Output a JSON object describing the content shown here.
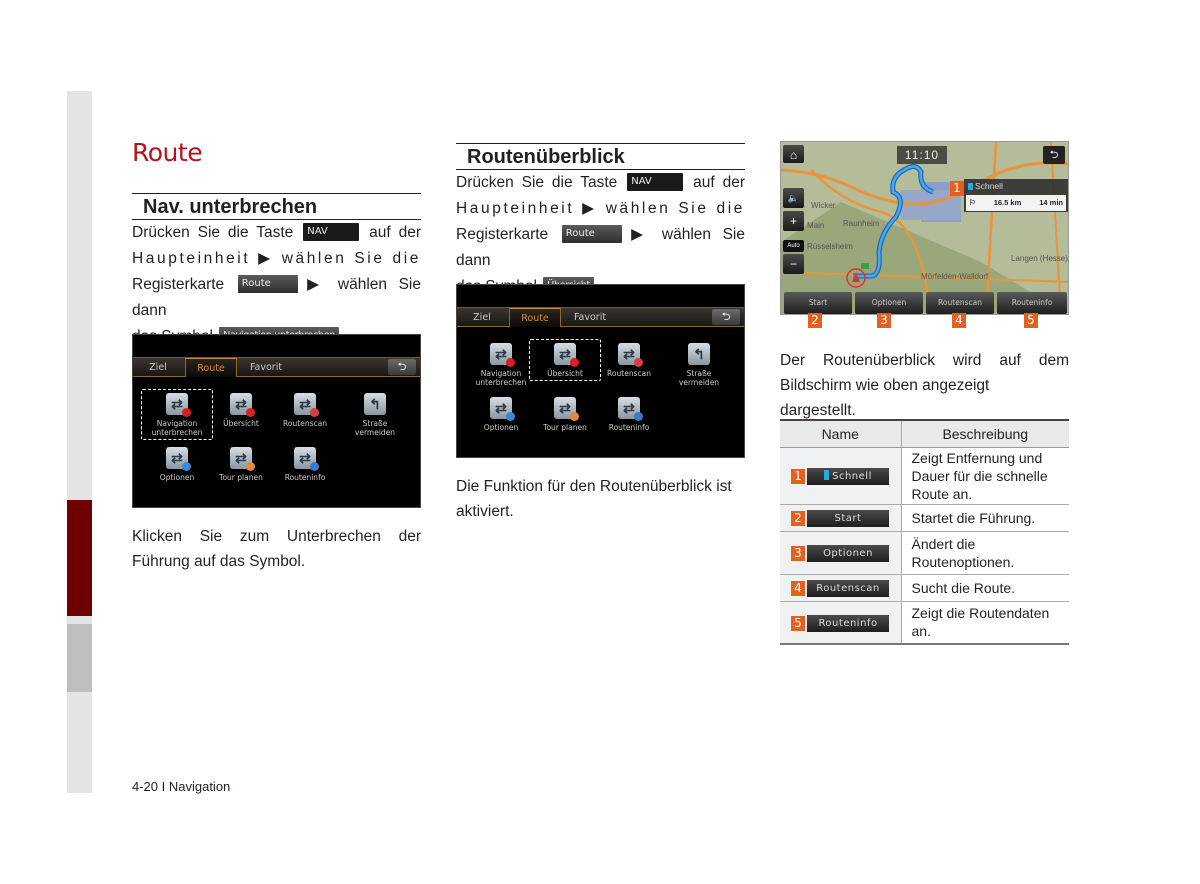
{
  "page": {
    "chapter_title": "Route",
    "footer": "4-20 I Navigation",
    "accent_color": "#b5121b",
    "sidebar_active_color": "#6e0000"
  },
  "section1": {
    "heading": "Nav. unterbrechen",
    "line1_a": "Drücken Sie die Taste",
    "nav_key": "NAV",
    "line1_b": "auf der",
    "line2": "Haupteinheit ▶ wählen Sie die",
    "line3_a": "Registerkarte",
    "route_key": "Route",
    "line3_b": "▶ wählen Sie dann",
    "line4_a": "das Symbol",
    "symbol_key": "Navigation unterbrechen",
    "line4_b": ".",
    "caption_line1": "Klicken Sie zum Unterbrechen der",
    "caption_line2": "Führung auf das Symbol."
  },
  "section2": {
    "heading": "Routenüberblick",
    "line1_a": "Drücken Sie die Taste",
    "nav_key": "NAV",
    "line1_b": "auf der",
    "line2": "Haupteinheit ▶ wählen Sie die",
    "line3_a": "Registerkarte",
    "route_key": "Route",
    "line3_b": "▶ wählen Sie dann",
    "line4_a": "das Symbol",
    "symbol_key": "Übersicht",
    "line4_b": ".",
    "caption_line1": "Die Funktion für den Routenüberblick ist",
    "caption_line2": "aktiviert."
  },
  "route_menu": {
    "tabs": [
      "Ziel",
      "Route",
      "Favorit"
    ],
    "active_tab": "Route",
    "back_icon": "⮌",
    "icons": [
      {
        "label1": "Navigation",
        "label2": "unterbrechen",
        "badge": "#d82020",
        "glyph": "⇄"
      },
      {
        "label1": "Übersicht",
        "label2": "",
        "badge": "#d82020",
        "glyph": "⇄"
      },
      {
        "label1": "Routenscan",
        "label2": "",
        "badge": "#d84040",
        "glyph": "⇄"
      },
      {
        "label1": "Straße",
        "label2": "vermeiden",
        "badge": "",
        "glyph": "↰"
      },
      {
        "label1": "Optionen",
        "label2": "",
        "badge": "#3a8ad8",
        "glyph": "⇄"
      },
      {
        "label1": "Tour planen",
        "label2": "",
        "badge": "#e08a40",
        "glyph": "⇄"
      },
      {
        "label1": "Routeninfo",
        "label2": "",
        "badge": "#3a7ac8",
        "glyph": "⇄"
      }
    ]
  },
  "map": {
    "clock": "11:10",
    "route_name": "Schnell",
    "distance": "16.5 km",
    "duration": "14 min",
    "labels": [
      "Wicker",
      "Raunheim",
      "Main",
      "Rüsselsheim",
      "Mörfelden-Walldorf",
      "Langen (Hesse)"
    ],
    "side_buttons": [
      "⌂",
      "🔈",
      "+",
      "Auto",
      "−"
    ],
    "bottom_buttons": [
      "Start",
      "Optionen",
      "Routenscan",
      "Routeninfo"
    ],
    "callouts": [
      "1",
      "2",
      "3",
      "4",
      "5"
    ]
  },
  "section3": {
    "text_line1": "Der Routenüberblick wird auf dem",
    "text_line2": "Bildschirm wie oben angezeigt dargestellt."
  },
  "table": {
    "headers": [
      "Name",
      "Beschreibung"
    ],
    "rows": [
      {
        "num": "1",
        "button": "Schnell",
        "desc": "Zeigt Entfernung und Dauer für die schnelle Route an."
      },
      {
        "num": "2",
        "button": "Start",
        "desc": "Startet die Führung."
      },
      {
        "num": "3",
        "button": "Optionen",
        "desc": "Ändert die Routenoptionen."
      },
      {
        "num": "4",
        "button": "Routenscan",
        "desc": "Sucht die Route."
      },
      {
        "num": "5",
        "button": "Routeninfo",
        "desc": "Zeigt die Routendaten an."
      }
    ]
  }
}
